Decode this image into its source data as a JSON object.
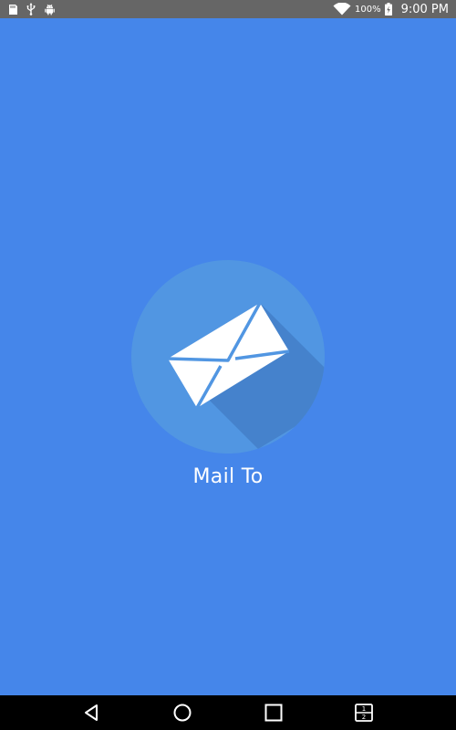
{
  "status_bar": {
    "left_icons": [
      "sd-card-icon",
      "usb-icon",
      "android-debug-icon"
    ],
    "wifi": "wifi-icon",
    "battery_percent": "100%",
    "battery_icon": "battery-charging-icon",
    "time": "9:00 PM"
  },
  "app": {
    "title": "Mail To",
    "logo_icon": "envelope-icon",
    "background_color": "#4586ea",
    "logo_circle_color": "#5196e2"
  },
  "nav_bar": {
    "buttons": [
      "back-icon",
      "home-icon",
      "recents-icon",
      "split-screen-icon"
    ],
    "split_label_top": "1",
    "split_label_bottom": "2"
  }
}
